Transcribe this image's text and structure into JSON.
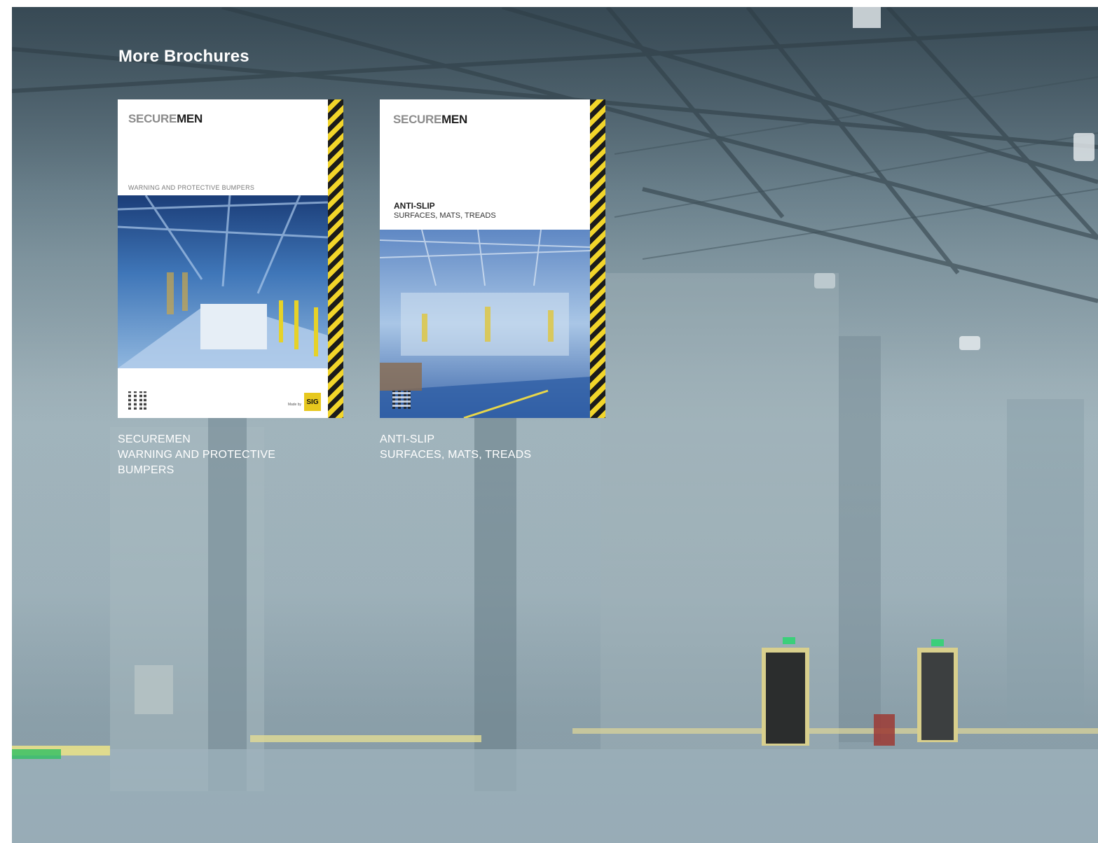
{
  "section": {
    "title": "More Brochures"
  },
  "brochures": [
    {
      "brand_light": "SECURE",
      "brand_dark": "MEN",
      "cover_subtitle": "WARNING AND PROTECTIVE BUMPERS",
      "made_by": "Made by",
      "logo_text": "SIG",
      "caption_line1": "SECUREMEN",
      "caption_line2": "WARNING AND PROTECTIVE\nBUMPERS"
    },
    {
      "brand_light": "SECURE",
      "brand_dark": "MEN",
      "cover_title": "ANTI-SLIP",
      "cover_subtitle": "SURFACES, MATS, TREADS",
      "caption_line1": "ANTI-SLIP",
      "caption_line2": "SURFACES, MATS, TREADS"
    }
  ],
  "colors": {
    "hazard_yellow": "#f2d52a",
    "hazard_black": "#1b1b1b",
    "caption_text": "#ffffff"
  }
}
